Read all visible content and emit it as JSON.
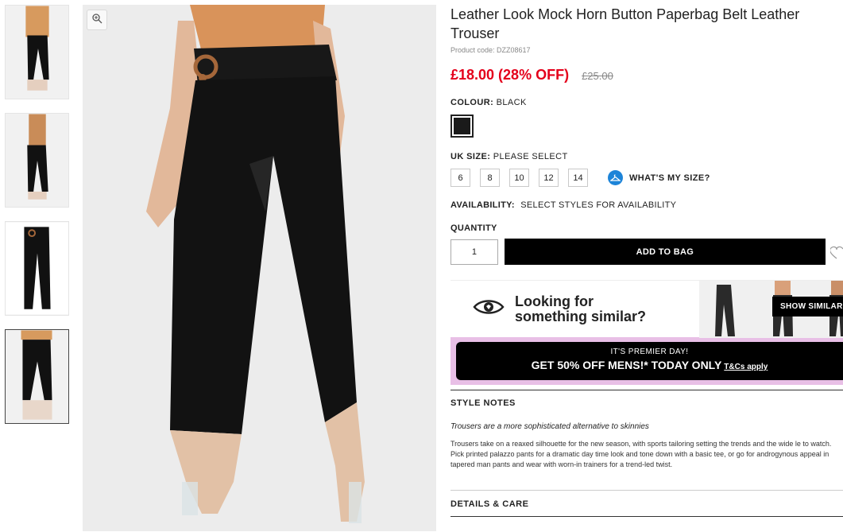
{
  "product": {
    "title": "Leather Look Mock Horn Button Paperbag Belt Leather Trouser",
    "product_code": "Product code: DZZ08617",
    "price_now": "£18.00 (28% OFF)",
    "price_was": "£25.00"
  },
  "colour": {
    "label": "COLOUR:",
    "value": "BLACK",
    "swatch_color": "#1a1a1a"
  },
  "size": {
    "label": "UK SIZE:",
    "value": "PLEASE SELECT",
    "options": [
      "6",
      "8",
      "10",
      "12",
      "14"
    ],
    "whats_my_size": "WHAT'S MY SIZE?"
  },
  "availability": {
    "label": "AVAILABILITY:",
    "value": "SELECT STYLES FOR AVAILABILITY"
  },
  "quantity": {
    "label": "QUANTITY",
    "value": "1"
  },
  "add_to_bag": "ADD TO BAG",
  "similar": {
    "line1": "Looking for",
    "line2": "something similar?",
    "button": "SHOW SIMILAR"
  },
  "promo": {
    "line1": "IT'S PREMIER DAY!",
    "line2": "GET 50% OFF MENS!* TODAY ONLY",
    "tc": "T&Cs apply",
    "bg": "#e8bfe6"
  },
  "style_notes": {
    "heading": "STYLE NOTES",
    "lead": "Trousers are a more sophisticated alternative to skinnies",
    "body": "Trousers take on a reaxed silhouette for the new season, with sports tailoring setting the trends and the wide le to watch. Pick printed palazzo pants for a dramatic day time look and tone down with a basic tee, or go for androgynous appeal in tapered man pants and wear with worn-in trainers for a trend-led twist."
  },
  "details_heading": "DETAILS & CARE",
  "colors": {
    "sale_red": "#e4001b",
    "info_blue": "#1d84d8"
  },
  "icons": [
    "zoom-icon",
    "ruler-icon",
    "heart-icon",
    "eye-icon"
  ]
}
